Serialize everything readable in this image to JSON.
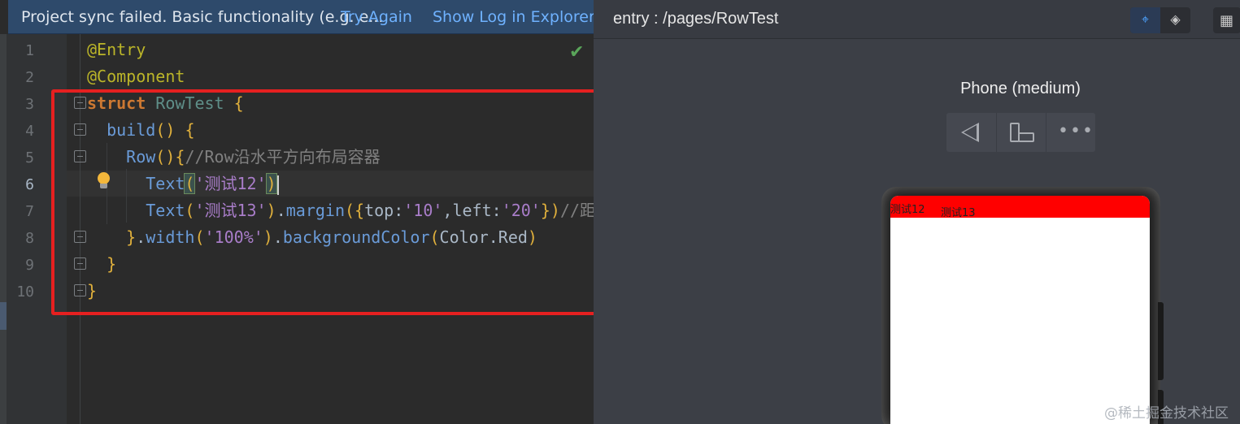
{
  "notification": {
    "message": "Project sync failed. Basic functionality (e.g. e...",
    "try_again": "Try Again",
    "show_log": "Show Log in Explorer"
  },
  "editor": {
    "line_numbers": [
      "1",
      "2",
      "3",
      "4",
      "5",
      "6",
      "7",
      "8",
      "9",
      "10"
    ],
    "current_line": 6
  },
  "code": {
    "l1": {
      "annotation": "@Entry"
    },
    "l2": {
      "annotation": "@Component"
    },
    "l3": {
      "keyword": "struct",
      "name": "RowTest",
      "brace": "{"
    },
    "l4": {
      "fn": "build",
      "parens": "()",
      "brace": "{"
    },
    "l5": {
      "fn": "Row",
      "parens": "()",
      "brace": "{",
      "comment": "//Row沿水平方向布局容器"
    },
    "l6": {
      "fn": "Text",
      "open": "(",
      "str": "'测试12'",
      "close": ")"
    },
    "l7": {
      "fn": "Text",
      "open": "(",
      "str": "'测试13'",
      "close": ")",
      "dot": ".",
      "method": "margin",
      "open2": "(",
      "brace_open": "{",
      "key1": "top",
      "colon1": ":",
      "val1": "'10'",
      "comma": ",",
      "key2": "left",
      "colon2": ":",
      "val2": "'20'",
      "brace_close": "}",
      "close2": ")",
      "comment": "//距"
    },
    "l8": {
      "brace": "}",
      "dot1": ".",
      "m1": "width",
      "open1": "(",
      "arg1": "'100%'",
      "close1": ")",
      "dot2": ".",
      "m2": "backgroundColor",
      "open2": "(",
      "arg2": "Color.Red",
      "close2": ")"
    },
    "l9": {
      "brace": "}"
    },
    "l10": {
      "brace": "}"
    }
  },
  "preview": {
    "title": "entry : /pages/RowTest",
    "device_name": "Phone (medium)",
    "row_text_1": "测试12",
    "row_text_2": "测试13",
    "row_color": "#ff0000",
    "more_glyph": "•••"
  },
  "watermark": "@稀土掘金技术社区",
  "colors": {
    "highlight_box": "#e62020",
    "notification_bg": "#2e4a6b",
    "link": "#6fb2ff"
  }
}
